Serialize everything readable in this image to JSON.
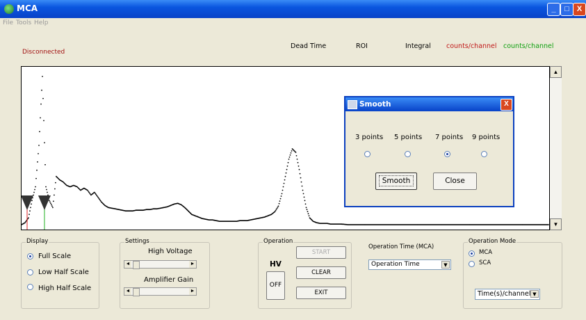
{
  "window": {
    "title": "MCA",
    "min_label": "_",
    "max_label": "□",
    "close_label": "X"
  },
  "menu": [
    "File",
    "Tools",
    "Help"
  ],
  "status": {
    "text": "Disconnected",
    "color": "#a01010"
  },
  "header": {
    "dead_time": "Dead Time",
    "roi": "ROI",
    "integral": "Integral",
    "counts_red": "counts/channel",
    "counts_green": "counts/channel"
  },
  "smooth_dialog": {
    "title": "Smooth",
    "options": [
      "3 points",
      "5 points",
      "7 points",
      "9 points"
    ],
    "selected_index": 2,
    "smooth_label": "Smooth",
    "close_label": "Close",
    "close_icon": "X"
  },
  "display": {
    "title": "Display",
    "options": [
      "Full Scale",
      "Low Half Scale",
      "High Half Scale"
    ],
    "selected_index": 0
  },
  "settings": {
    "title": "Settings",
    "high_voltage": "High Voltage",
    "amplifier_gain": "Amplifier Gain"
  },
  "operation": {
    "title": "Operation",
    "hv": "HV",
    "off": "OFF",
    "start": "START",
    "clear": "CLEAR",
    "exit": "EXIT"
  },
  "operation_time": {
    "label": "Operation Time (MCA)",
    "value": "Operation Time"
  },
  "operation_mode": {
    "title": "Operation Mode",
    "options": [
      "MCA",
      "SCA"
    ],
    "selected_index": 0,
    "select_value": "Time(s)/channel"
  },
  "icons": {
    "arrow_left": "◄",
    "arrow_right": "►",
    "arrow_up": "▲",
    "arrow_down": "▼"
  },
  "colors": {
    "marker_red": "#e02020",
    "marker_green": "#20b020",
    "counts_red": "#c01818",
    "counts_green": "#10a010"
  },
  "chart_data": {
    "type": "scatter",
    "title": "",
    "xlabel": "",
    "ylabel": "",
    "x": [
      0,
      5,
      10,
      15,
      20,
      25,
      30,
      35,
      40,
      45,
      50,
      55,
      60,
      65,
      70,
      75,
      80,
      85,
      90,
      95,
      100,
      105,
      110,
      115,
      120,
      125,
      130,
      135,
      140,
      145,
      150,
      155,
      160,
      165,
      170,
      175,
      180,
      185,
      190,
      195,
      200,
      205,
      210,
      215,
      220,
      225,
      230,
      235,
      240,
      245,
      250,
      255,
      260,
      265,
      270,
      275,
      280,
      285,
      290,
      295,
      300,
      305,
      310,
      315,
      320,
      325,
      330,
      335,
      340,
      345,
      350,
      355,
      360,
      365,
      370,
      375,
      380,
      385,
      390,
      395,
      400,
      405,
      410,
      415,
      420,
      425,
      430,
      435,
      440,
      445,
      450,
      455,
      460,
      470,
      480,
      500,
      520,
      540,
      560,
      580,
      600,
      620,
      640,
      660,
      680,
      700,
      720,
      740,
      760
    ],
    "y": [
      5,
      8,
      15,
      40,
      60,
      120,
      220,
      60,
      40,
      30,
      75,
      70,
      67,
      62,
      60,
      62,
      60,
      55,
      58,
      55,
      48,
      52,
      45,
      38,
      33,
      30,
      29,
      28,
      27,
      26,
      25,
      25,
      25,
      26,
      26,
      26,
      27,
      27,
      28,
      28,
      29,
      30,
      31,
      33,
      35,
      36,
      34,
      30,
      25,
      20,
      18,
      16,
      14,
      13,
      12,
      12,
      11,
      10,
      10,
      10,
      10,
      10,
      10,
      11,
      11,
      11,
      12,
      13,
      14,
      15,
      16,
      18,
      20,
      24,
      32,
      50,
      75,
      100,
      115,
      110,
      85,
      55,
      30,
      15,
      10,
      8,
      7,
      7,
      7,
      6,
      6,
      6,
      6,
      5,
      5,
      5,
      5,
      5,
      5,
      5,
      5,
      5,
      5,
      5,
      5,
      5,
      5,
      5,
      5
    ],
    "markers": [
      {
        "x": 8,
        "color": "#e02020"
      },
      {
        "x": 33,
        "color": "#20b020"
      }
    ],
    "grid": false
  }
}
